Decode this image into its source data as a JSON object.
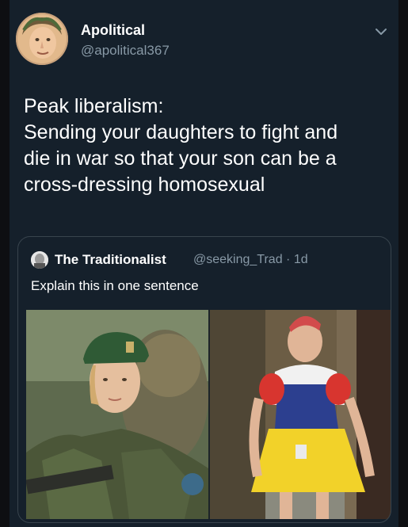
{
  "author": {
    "name": "Apolitical",
    "handle": "@apolitical367"
  },
  "tweet": {
    "lines": [
      "Peak liberalism:",
      "Sending your daughters to fight and",
      "die in war so that your son can be a",
      "cross-dressing homosexual"
    ]
  },
  "quoted": {
    "name": "The Traditionalist",
    "meta": "@seeking_Trad · 1d",
    "text": "Explain this in one sentence"
  },
  "icons": {
    "menu": "chevron-down-icon",
    "avatar": "avatar",
    "quoted_avatar": "quoted-avatar"
  },
  "colors": {
    "background": "#15202b",
    "secondary_text": "#8899a6",
    "border": "#38444d"
  }
}
